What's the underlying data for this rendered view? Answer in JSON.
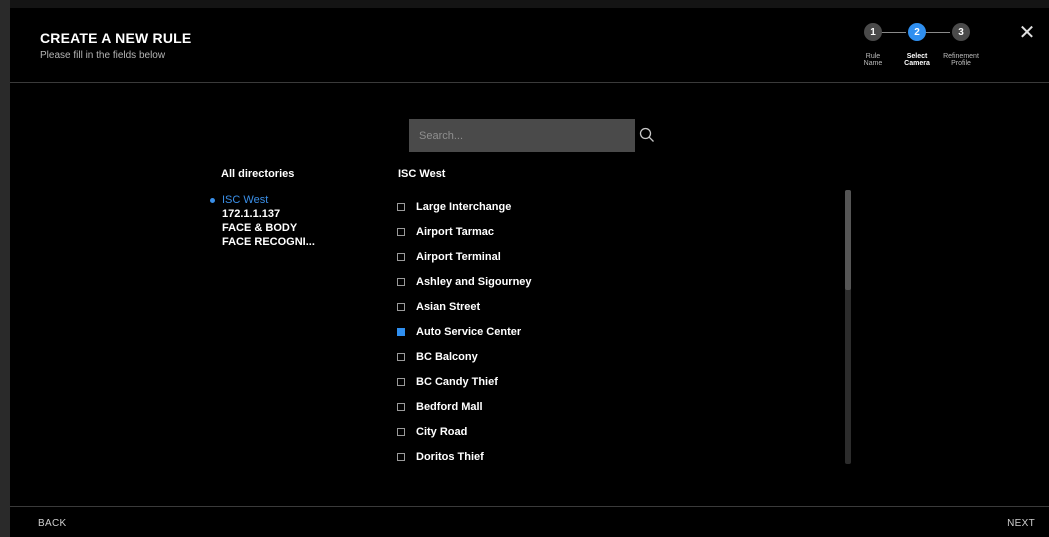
{
  "header": {
    "title": "CREATE A NEW RULE",
    "subtitle": "Please fill in the fields below",
    "close_symbol": "✕"
  },
  "stepper": {
    "steps": [
      {
        "number": "1",
        "label_line1": "Rule",
        "label_line2": "Name"
      },
      {
        "number": "2",
        "label_line1": "Select",
        "label_line2": "Camera"
      },
      {
        "number": "3",
        "label_line1": "Refinement",
        "label_line2": "Profile"
      }
    ],
    "active_index": 1
  },
  "search": {
    "placeholder": "Search...",
    "value": "",
    "icon": "search-icon"
  },
  "directories": {
    "title": "All directories",
    "items": [
      {
        "label": "ISC West",
        "selected": true
      },
      {
        "label": "172.1.1.137",
        "selected": false
      },
      {
        "label": "FACE & BODY",
        "selected": false
      },
      {
        "label": "FACE RECOGNI...",
        "selected": false
      }
    ]
  },
  "cameras": {
    "title": "ISC West",
    "items": [
      {
        "label": "Large Interchange",
        "checked": false
      },
      {
        "label": "Airport Tarmac",
        "checked": false
      },
      {
        "label": "Airport Terminal",
        "checked": false
      },
      {
        "label": "Ashley and Sigourney",
        "checked": false
      },
      {
        "label": "Asian Street",
        "checked": false
      },
      {
        "label": "Auto Service Center",
        "checked": true
      },
      {
        "label": "BC Balcony",
        "checked": false
      },
      {
        "label": "BC Candy Thief",
        "checked": false
      },
      {
        "label": "Bedford Mall",
        "checked": false
      },
      {
        "label": "City Road",
        "checked": false
      },
      {
        "label": "Doritos Thief",
        "checked": false
      }
    ]
  },
  "footer": {
    "back_label": "BACK",
    "next_label": "NEXT"
  },
  "colors": {
    "accent": "#2f8ff0",
    "background": "#000000",
    "search_bg": "#4a4a4a"
  }
}
